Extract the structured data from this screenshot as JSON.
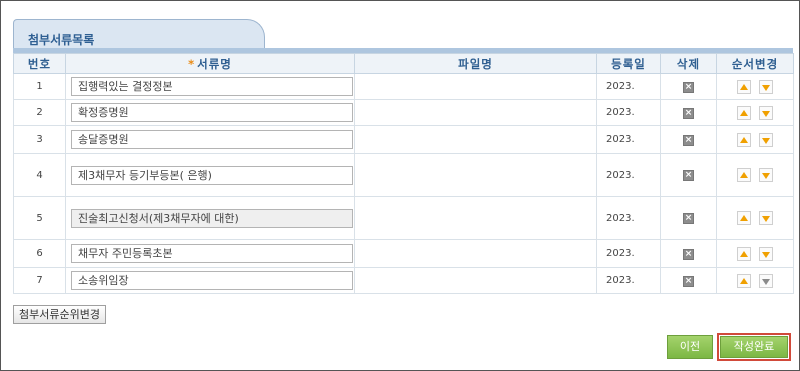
{
  "section": {
    "title": "첨부서류목록"
  },
  "table": {
    "headers": {
      "no": "번호",
      "required_mark": "*",
      "doc_name": "서류명",
      "file_name": "파일명",
      "reg_date": "등록일",
      "delete": "삭제",
      "order": "순서변경"
    },
    "rows": [
      {
        "no": "1",
        "doc_name": "집행력있는 결정정본",
        "file_name": "",
        "reg_date": "2023.",
        "readonly": false,
        "down_enabled": true
      },
      {
        "no": "2",
        "doc_name": "확정증명원",
        "file_name": "",
        "reg_date": "2023.",
        "readonly": false,
        "down_enabled": true
      },
      {
        "no": "3",
        "doc_name": "송달증명원",
        "file_name": "",
        "reg_date": "2023.",
        "readonly": false,
        "down_enabled": true
      },
      {
        "no": "4",
        "doc_name": "제3채무자 등기부등본(      은행)",
        "file_name": "",
        "reg_date": "2023.",
        "readonly": false,
        "down_enabled": true
      },
      {
        "no": "5",
        "doc_name": "진술최고신청서(제3채무자에 대한)",
        "file_name": "",
        "reg_date": "2023.",
        "readonly": true,
        "down_enabled": true
      },
      {
        "no": "6",
        "doc_name": "채무자 주민등록초본",
        "file_name": "",
        "reg_date": "2023.",
        "readonly": false,
        "down_enabled": true
      },
      {
        "no": "7",
        "doc_name": "소송위임장",
        "file_name": "",
        "reg_date": "2023.",
        "readonly": false,
        "down_enabled": false
      }
    ]
  },
  "buttons": {
    "reorder": "첨부서류순위변경",
    "prev": "이전",
    "complete": "작성완료"
  },
  "icons": {
    "delete": "x-box-icon",
    "move_up": "arrow-up-icon",
    "move_down": "arrow-down-icon"
  },
  "colors": {
    "accent": "#2f5f91",
    "button_green": "#7cb744",
    "highlight_border": "#d14a3a",
    "arrow": "#f0a000"
  }
}
